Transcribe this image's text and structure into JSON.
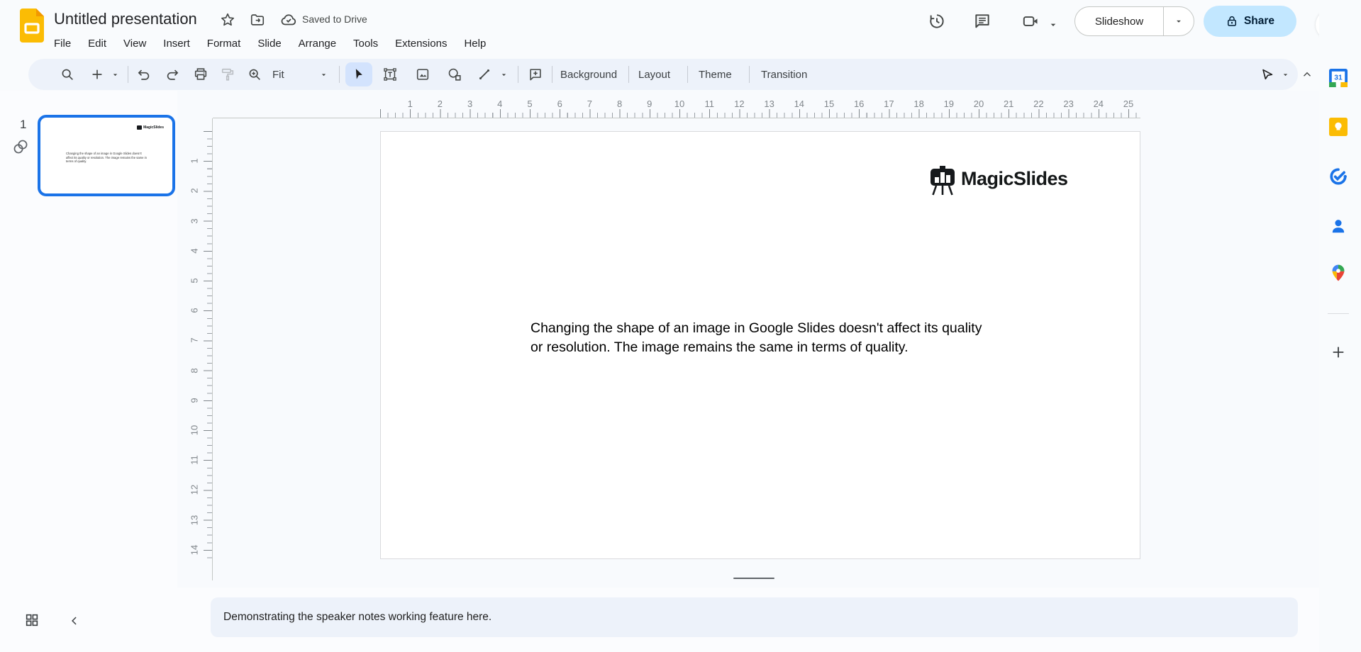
{
  "header": {
    "title": "Untitled presentation",
    "saved_status": "Saved to Drive",
    "menus": [
      "File",
      "Edit",
      "View",
      "Insert",
      "Format",
      "Slide",
      "Arrange",
      "Tools",
      "Extensions",
      "Help"
    ],
    "slideshow_label": "Slideshow",
    "share_label": "Share"
  },
  "toolbar": {
    "zoom_mode": "Fit",
    "background_label": "Background",
    "layout_label": "Layout",
    "theme_label": "Theme",
    "transition_label": "Transition"
  },
  "filmstrip": {
    "slide_number": "1"
  },
  "slide": {
    "logo_text": "MagicSlides",
    "text_line1": "Changing the shape of an image in Google Slides doesn't affect its quality",
    "text_line2": "or resolution. The image remains the same in terms of quality."
  },
  "notes": {
    "text": "Demonstrating the speaker notes working feature here."
  },
  "rulers": {
    "horizontal": [
      1,
      2,
      3,
      4,
      5,
      6,
      7,
      8,
      9,
      10,
      11,
      12,
      13,
      14,
      15,
      16,
      17,
      18,
      19,
      20,
      21,
      22,
      23,
      24,
      25
    ],
    "vertical": [
      1,
      2,
      3,
      4,
      5,
      6,
      7,
      8,
      9,
      10,
      11,
      12,
      13,
      14
    ]
  },
  "sidebar": {
    "calendar_day": "31"
  },
  "colors": {
    "accent_blue": "#1a73e8",
    "share_bg": "#c2e7ff",
    "toolbar_bg": "#edf2fa",
    "selected_chip": "#d3e3fd",
    "slides_yellow": "#fbbc04"
  }
}
